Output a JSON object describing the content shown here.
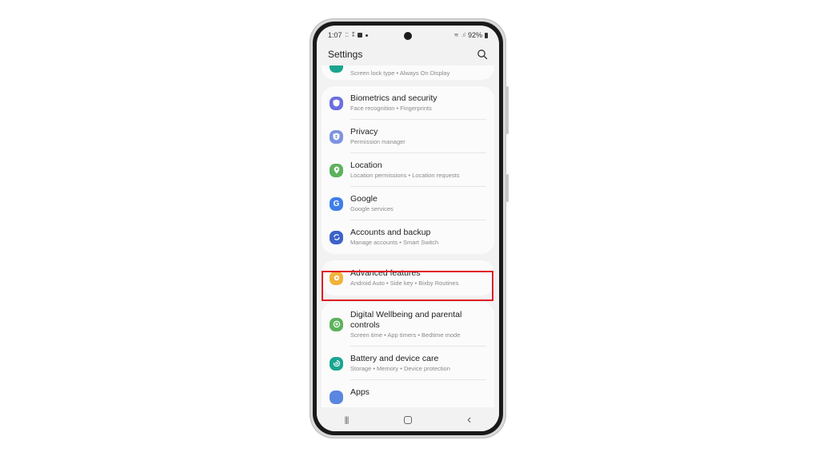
{
  "status_bar": {
    "time": "1:07",
    "notification_icons": [
      "cast-icon",
      "screen-record-icon",
      "bag-icon",
      "dot-icon"
    ],
    "battery": "92%"
  },
  "app_bar": {
    "title": "Settings",
    "search_icon": "search-icon"
  },
  "partial_top_item": {
    "subtitle": "Screen lock type  •  Always On Display",
    "icon_color": "#1aa58f"
  },
  "card1": {
    "items": [
      {
        "title": "Biometrics and security",
        "subtitle": "Face recognition  •  Fingerprints",
        "icon": "shield-icon",
        "color": "#6b6ee0"
      },
      {
        "title": "Privacy",
        "subtitle": "Permission manager",
        "icon": "privacy-shield-icon",
        "color": "#7d93e0"
      },
      {
        "title": "Location",
        "subtitle": "Location permissions  •  Location requests",
        "icon": "location-pin-icon",
        "color": "#5cb25c"
      },
      {
        "title": "Google",
        "subtitle": "Google services",
        "icon": "google-icon",
        "color": "#3f7ee8"
      },
      {
        "title": "Accounts and backup",
        "subtitle": "Manage accounts  •  Smart Switch",
        "icon": "sync-icon",
        "color": "#3c62c9"
      }
    ]
  },
  "card2": {
    "items": [
      {
        "title": "Advanced features",
        "subtitle": "Android Auto  •  Side key  •  Bixby Routines",
        "icon": "gear-plus-icon",
        "color": "#f2b33d"
      }
    ]
  },
  "card3": {
    "items": [
      {
        "title": "Digital Wellbeing and parental controls",
        "subtitle": "Screen time  •  App timers  •  Bedtime mode",
        "icon": "wellbeing-icon",
        "color": "#5cb25c"
      },
      {
        "title": "Battery and device care",
        "subtitle": "Storage  •  Memory  •  Device protection",
        "icon": "device-care-icon",
        "color": "#1aa58f"
      },
      {
        "title": "Apps",
        "subtitle": "",
        "icon": "apps-icon",
        "color": "#5b86e0"
      }
    ]
  },
  "nav_bar": {
    "recents": "|||",
    "home": "○",
    "back": "‹"
  },
  "highlight_color": "#e01e25"
}
